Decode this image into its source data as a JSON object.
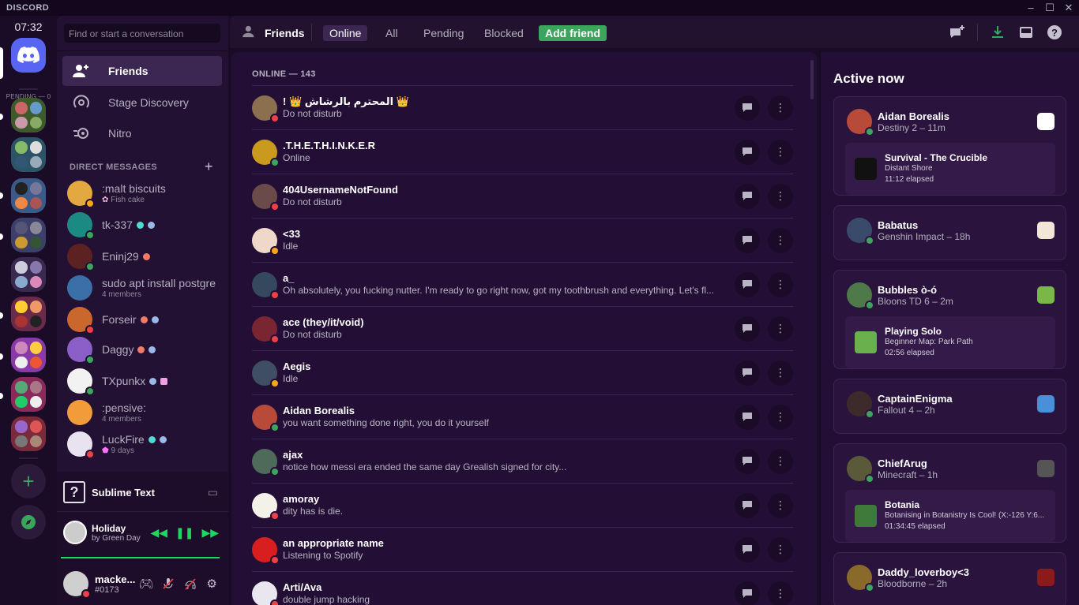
{
  "window": {
    "brand": "DISCORD"
  },
  "rail": {
    "clock": "07:32",
    "pending": "PENDING — 0"
  },
  "sidebar": {
    "search_placeholder": "Find or start a conversation",
    "nav": [
      {
        "label": "Friends",
        "icon": "friends-icon"
      },
      {
        "label": "Stage Discovery",
        "icon": "stage-icon"
      },
      {
        "label": "Nitro",
        "icon": "nitro-icon"
      }
    ],
    "dm_header": "DIRECT MESSAGES",
    "dms": [
      {
        "name": ":malt biscuits",
        "sub": "Fish cake",
        "color": "#e3a840",
        "status": "#faa61a"
      },
      {
        "name": "tk-337",
        "sub": "",
        "color": "#1b8a83",
        "status": "#3ba55c"
      },
      {
        "name": "Eninj29",
        "sub": "",
        "color": "#5c2222",
        "status": "#3ba55c"
      },
      {
        "name": "sudo apt install postgre",
        "sub": "4 members",
        "color": "#3a6fa8",
        "status": ""
      },
      {
        "name": "Forseir",
        "sub": "",
        "color": "#c9672c",
        "status": "#ed4245"
      },
      {
        "name": "Daggy",
        "sub": "",
        "color": "#8a5fc7",
        "status": "#3ba55c"
      },
      {
        "name": "TXpunkx",
        "sub": "",
        "color": "#f2f2f2",
        "status": "#3ba55c"
      },
      {
        "name": ":pensive:",
        "sub": "4 members",
        "color": "#f29b3b",
        "status": ""
      },
      {
        "name": "LuckFire",
        "sub": "9 days",
        "color": "#e9e3f0",
        "status": "#ed4245"
      }
    ]
  },
  "activity": {
    "game": "Sublime Text",
    "song_title": "Holiday",
    "song_artist": "by Green Day"
  },
  "user": {
    "name": "macke...",
    "tag": "#0173"
  },
  "topbar": {
    "friends": "Friends",
    "tabs": [
      "Online",
      "All",
      "Pending",
      "Blocked"
    ],
    "add_friend": "Add friend"
  },
  "list": {
    "header": "ONLINE — 143",
    "friends": [
      {
        "name": "! 👑 المحترم بالرشاش 👑",
        "status": "Do not disturb",
        "color": "#8b6f4e",
        "dot": "#ed4245"
      },
      {
        "name": ".T.H.E.T.H.I.N.K.E.R",
        "status": "Online",
        "color": "#c99a1d",
        "dot": "#3ba55c"
      },
      {
        "name": "404UsernameNotFound",
        "status": "Do not disturb",
        "color": "#6b4a4a",
        "dot": "#ed4245"
      },
      {
        "name": "<33",
        "status": "Idle",
        "color": "#f0d8c8",
        "dot": "#faa61a"
      },
      {
        "name": "a_",
        "status": "Oh absolutely, you fucking nutter. I'm ready to go right now, got my toothbrush and everything. Let's fl...",
        "color": "#34495e",
        "dot": "#ed4245"
      },
      {
        "name": "ace (they/it/void)",
        "status": "Do not disturb",
        "color": "#7a2632",
        "dot": "#ed4245"
      },
      {
        "name": "Aegis",
        "status": "Idle",
        "color": "#3f4e63",
        "dot": "#faa61a"
      },
      {
        "name": "Aidan Borealis",
        "status": "you want something done right, you do it yourself",
        "color": "#b84a3a",
        "dot": "#3ba55c"
      },
      {
        "name": "ajax",
        "status": "notice how messi era ended the same day Grealish signed for city...",
        "color": "#4e6b5a",
        "dot": "#3ba55c"
      },
      {
        "name": "amoray",
        "status": "dity has is die.",
        "color": "#f4f1e8",
        "dot": "#ed4245"
      },
      {
        "name": "an appropriate name",
        "status": "Listening to Spotify",
        "color": "#d81e1e",
        "dot": "#ed4245"
      },
      {
        "name": "Arti/Ava",
        "status": "double jump hacking",
        "color": "#e9e6ef",
        "dot": "#ed4245"
      }
    ]
  },
  "active_now": {
    "title": "Active now",
    "cards": [
      {
        "name": "Aidan Borealis",
        "sub": "Destiny 2 – 11m",
        "game_color": "#ffffff",
        "color": "#b84a3a",
        "detail": {
          "title": "Survival - The Crucible",
          "line1": "Distant Shore",
          "line2": "11:12 elapsed",
          "color": "#111111"
        }
      },
      {
        "name": "Babatus",
        "sub": "Genshin Impact – 18h",
        "game_color": "#f2e6d8",
        "color": "#3a4a6b",
        "detail": null
      },
      {
        "name": "Bubbles ò-ó",
        "sub": "Bloons TD 6 – 2m",
        "game_color": "#7ab648",
        "color": "#4e7a4a",
        "detail": {
          "title": "Playing Solo",
          "line1": "Beginner Map: Park Path",
          "line2": "02:56 elapsed",
          "color": "#6ab04c"
        }
      },
      {
        "name": "CaptainEnigma",
        "sub": "Fallout 4 – 2h",
        "game_color": "#4a90d9",
        "color": "#3d2b2b",
        "detail": null
      },
      {
        "name": "ChiefArug",
        "sub": "Minecraft – 1h",
        "game_color": "#555555",
        "color": "#5a5a3a",
        "detail": {
          "title": "Botania",
          "line1": "Botanising in Botanistry Is Cool! (X:-126 Y:6...",
          "line2": "01:34:45 elapsed",
          "color": "#3f7a3a"
        }
      },
      {
        "name": "Daddy_loverboy<3",
        "sub": "Bloodborne – 2h",
        "game_color": "#8b1a1a",
        "color": "#8a6a2a",
        "detail": null
      }
    ]
  }
}
